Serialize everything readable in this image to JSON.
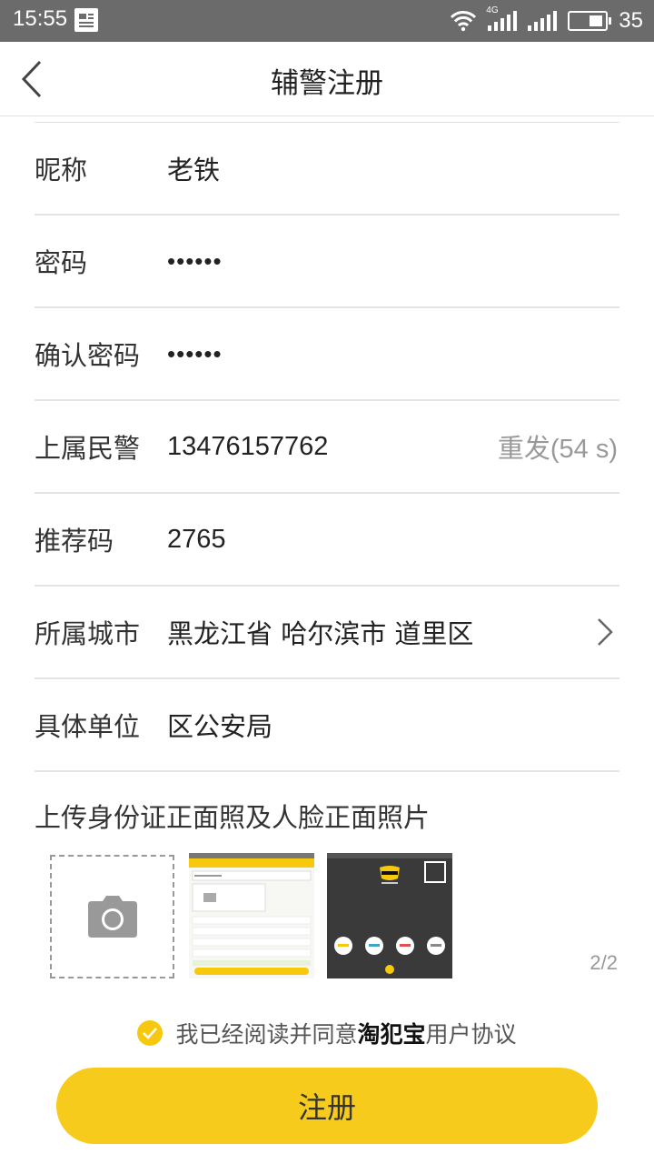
{
  "status_bar": {
    "time": "15:55",
    "network": "4G",
    "battery": "35"
  },
  "header": {
    "title": "辅警注册"
  },
  "form": {
    "nickname": {
      "label": "昵称",
      "value": "老铁"
    },
    "password": {
      "label": "密码",
      "value": "••••••"
    },
    "confirm_password": {
      "label": "确认密码",
      "value": "••••••"
    },
    "superior_police": {
      "label": "上属民警",
      "value": "13476157762",
      "resend": "重发(54 s)"
    },
    "referral_code": {
      "label": "推荐码",
      "value": "2765"
    },
    "city": {
      "label": "所属城市",
      "value": "黑龙江省 哈尔滨市 道里区"
    },
    "unit": {
      "label": "具体单位",
      "value": "区公安局"
    }
  },
  "upload": {
    "title": "上传身份证正面照及人脸正面照片",
    "counter": "2/2"
  },
  "agreement": {
    "prefix": "我已经阅读并同意",
    "brand": "淘犯宝",
    "suffix": "用户协议"
  },
  "submit": {
    "label": "注册"
  },
  "colors": {
    "accent": "#f7cb1b",
    "status_bar": "#6b6b6b",
    "divider": "#e4e4e4"
  }
}
